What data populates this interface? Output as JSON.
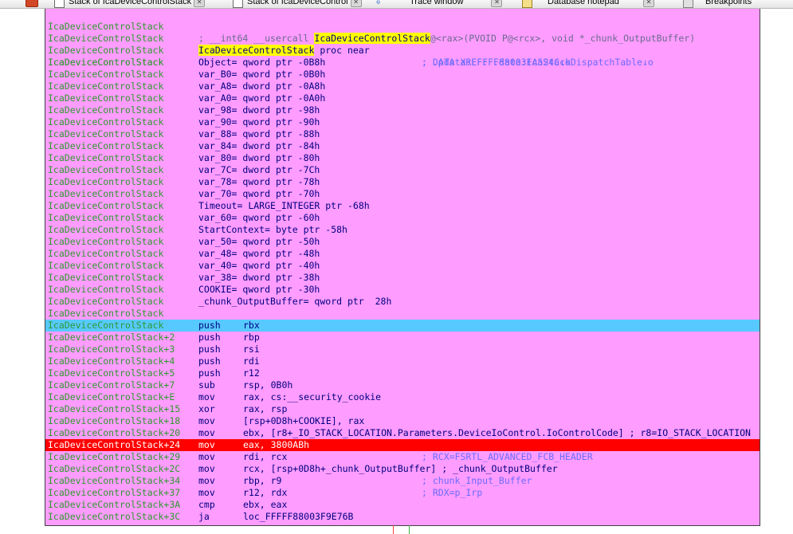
{
  "tabs": [
    {
      "label": "Stack of IcaDeviceControlStack"
    },
    {
      "label": "Stack of IcaDeviceControl"
    },
    {
      "label": "Trace window"
    },
    {
      "label": "Database notepad"
    },
    {
      "label": "Breakpoints"
    }
  ],
  "header": {
    "addr": "IcaDeviceControlStack",
    "decl_prefix": "; __int64 __usercall ",
    "decl_func": "IcaDeviceControlStack",
    "decl_suffix": "@<rax>(PVOID P@<rcx>, void *_chunk_OutputBuffer)",
    "proc_name": "IcaDeviceControlStack",
    "proc_kw": " proc near",
    "xref1": "; DATA XREF: .data:IcaStackDispatchTable↓o",
    "xref2": "; .pdata:FFFFF88003FA524C↓o"
  },
  "vars": [
    {
      "name": "Object",
      "type": "qword ptr",
      "offset": "-0B8h"
    },
    {
      "name": "var_B0",
      "type": "qword ptr",
      "offset": "-0B0h"
    },
    {
      "name": "var_A8",
      "type": "dword ptr",
      "offset": "-0A8h"
    },
    {
      "name": "var_A0",
      "type": "qword ptr",
      "offset": "-0A0h"
    },
    {
      "name": "var_98",
      "type": "dword ptr",
      "offset": "-98h"
    },
    {
      "name": "var_90",
      "type": "qword ptr",
      "offset": "-90h"
    },
    {
      "name": "var_88",
      "type": "qword ptr",
      "offset": "-88h"
    },
    {
      "name": "var_84",
      "type": "dword ptr",
      "offset": "-84h"
    },
    {
      "name": "var_80",
      "type": "dword ptr",
      "offset": "-80h"
    },
    {
      "name": "var_7C",
      "type": "dword ptr",
      "offset": "-7Ch"
    },
    {
      "name": "var_78",
      "type": "qword ptr",
      "offset": "-78h"
    },
    {
      "name": "var_70",
      "type": "qword ptr",
      "offset": "-70h"
    },
    {
      "name": "Timeout",
      "type": "LARGE_INTEGER ptr",
      "offset": "-68h"
    },
    {
      "name": "var_60",
      "type": "qword ptr",
      "offset": "-60h"
    },
    {
      "name": "StartContext",
      "type": "byte ptr",
      "offset": "-58h"
    },
    {
      "name": "var_50",
      "type": "qword ptr",
      "offset": "-50h"
    },
    {
      "name": "var_48",
      "type": "qword ptr",
      "offset": "-48h"
    },
    {
      "name": "var_40",
      "type": "qword ptr",
      "offset": "-40h"
    },
    {
      "name": "var_38",
      "type": "dword ptr",
      "offset": "-38h"
    },
    {
      "name": "COOKIE",
      "type": "qword ptr",
      "offset": "-30h"
    },
    {
      "name": "_chunk_OutputBuffer",
      "type": "qword ptr",
      "offset": " 28h"
    }
  ],
  "blank_addr": "IcaDeviceControlStack",
  "instructions": [
    {
      "addr": "IcaDeviceControlStack",
      "mn": "push",
      "op": "rbx",
      "cmt": "",
      "hl": "blue"
    },
    {
      "addr": "IcaDeviceControlStack+2",
      "mn": "push",
      "op": "rbp",
      "cmt": "",
      "hl": ""
    },
    {
      "addr": "IcaDeviceControlStack+3",
      "mn": "push",
      "op": "rsi",
      "cmt": "",
      "hl": ""
    },
    {
      "addr": "IcaDeviceControlStack+4",
      "mn": "push",
      "op": "rdi",
      "cmt": "",
      "hl": ""
    },
    {
      "addr": "IcaDeviceControlStack+5",
      "mn": "push",
      "op": "r12",
      "cmt": "",
      "hl": ""
    },
    {
      "addr": "IcaDeviceControlStack+7",
      "mn": "sub",
      "op": "rsp, 0B0h",
      "cmt": "",
      "hl": ""
    },
    {
      "addr": "IcaDeviceControlStack+E",
      "mn": "mov",
      "op": "rax, cs:__security_cookie",
      "cmt": "",
      "hl": ""
    },
    {
      "addr": "IcaDeviceControlStack+15",
      "mn": "xor",
      "op": "rax, rsp",
      "cmt": "",
      "hl": ""
    },
    {
      "addr": "IcaDeviceControlStack+18",
      "mn": "mov",
      "op": "[rsp+0D8h+COOKIE], rax",
      "cmt": "",
      "hl": ""
    },
    {
      "addr": "IcaDeviceControlStack+20",
      "mn": "mov",
      "op": "ebx, [r8+_IO_STACK_LOCATION.Parameters.DeviceIoControl.IoControlCode] ; r8=IO_STACK_LOCATION",
      "cmt": "",
      "hl": ""
    },
    {
      "addr": "IcaDeviceControlStack+24",
      "mn": "mov",
      "op": "eax, 3800ABh",
      "cmt": "",
      "hl": "red"
    },
    {
      "addr": "IcaDeviceControlStack+29",
      "mn": "mov",
      "op": "rdi, rcx",
      "cmt": "; RCX=FSRTL_ADVANCED_FCB_HEADER",
      "hl": ""
    },
    {
      "addr": "IcaDeviceControlStack+2C",
      "mn": "mov",
      "op": "rcx, [rsp+0D8h+_chunk_OutputBuffer] ; _chunk_OutputBuffer",
      "cmt": "",
      "hl": ""
    },
    {
      "addr": "IcaDeviceControlStack+34",
      "mn": "mov",
      "op": "rbp, r9",
      "cmt": "; chunk_Input_Buffer",
      "hl": ""
    },
    {
      "addr": "IcaDeviceControlStack+37",
      "mn": "mov",
      "op": "r12, rdx",
      "cmt": "; RDX=p_Irp",
      "hl": ""
    },
    {
      "addr": "IcaDeviceControlStack+3A",
      "mn": "cmp",
      "op": "ebx, eax",
      "cmt": "",
      "hl": ""
    },
    {
      "addr": "IcaDeviceControlStack+3C",
      "mn": "ja",
      "op": "loc_FFFFF88003F9E76B",
      "cmt": "",
      "hl": ""
    }
  ]
}
